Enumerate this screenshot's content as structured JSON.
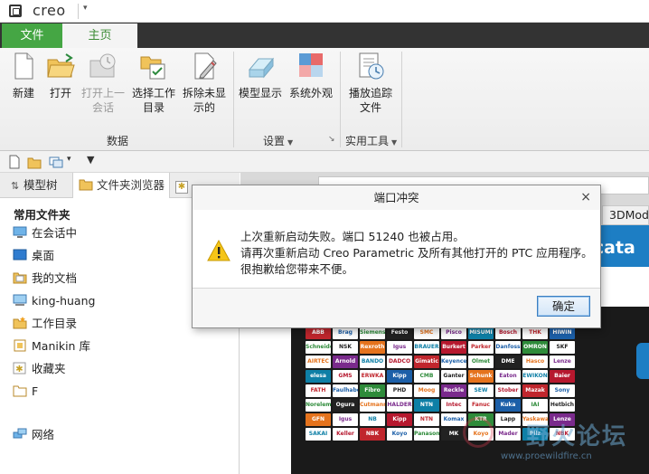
{
  "app": {
    "brand": "creo"
  },
  "tabs": [
    {
      "label": "文件",
      "active": false
    },
    {
      "label": "主页",
      "active": true
    }
  ],
  "ribbon": {
    "buttons": [
      {
        "id": "new",
        "label": "新建",
        "icon": "new-file-icon"
      },
      {
        "id": "open",
        "label": "打开",
        "icon": "open-folder-icon"
      },
      {
        "id": "open-last",
        "label_line1": "打开上一",
        "label_line2": "会话",
        "disabled": true,
        "icon": "open-last-session-icon"
      },
      {
        "id": "select-wd",
        "label_line1": "选择工作",
        "label_line2": "目录",
        "icon": "select-working-directory-icon"
      },
      {
        "id": "erase",
        "label_line1": "拆除未显",
        "label_line2": "示的",
        "icon": "erase-not-displayed-icon"
      },
      {
        "id": "model-display",
        "label": "模型显示",
        "icon": "model-display-icon"
      },
      {
        "id": "system-appearance",
        "label": "系统外观",
        "icon": "system-appearance-icon"
      },
      {
        "id": "playback",
        "label_line1": "播放追踪",
        "label_line2": "文件",
        "icon": "playback-trail-file-icon"
      }
    ],
    "groups": {
      "data": "数据",
      "settings": "设置",
      "utilities": "实用工具"
    }
  },
  "navigator": {
    "tabs": [
      {
        "label": "模型树"
      },
      {
        "label": "文件夹浏览器"
      },
      {
        "label": "收藏夹"
      }
    ],
    "favorites_header": "常用文件夹",
    "items": [
      {
        "label": "在会话中",
        "icon": "monitor-icon"
      },
      {
        "label": "桌面",
        "icon": "desktop-icon"
      },
      {
        "label": "我的文档",
        "icon": "documents-icon"
      },
      {
        "label": "king-huang",
        "icon": "computer-icon"
      },
      {
        "label": "工作目录",
        "icon": "working-directory-icon"
      },
      {
        "label": "Manikin 库",
        "icon": "library-icon"
      },
      {
        "label": "收藏夹",
        "icon": "favorites-icon"
      },
      {
        "label": "F",
        "icon": "folder-icon"
      },
      {
        "label": "网络",
        "icon": "network-icon"
      }
    ]
  },
  "browser": {
    "tab_label": "3DModel",
    "banner_text": "er cata",
    "logos": [
      "ABB",
      "Brag",
      "Siemens",
      "Festo",
      "SMC",
      "Pisco",
      "MISUMI",
      "Bosch",
      "THK",
      "HIWIN",
      "Schneider",
      "NSK",
      "Rexroth",
      "Igus",
      "BRAUER",
      "Burkert",
      "Parker",
      "Danfoss",
      "OMRON",
      "SKF",
      "AIRTEC",
      "Arnold",
      "BANDO",
      "DADCO",
      "Gimatic",
      "Keyence",
      "Olmet",
      "DME",
      "Hasco",
      "Lenze",
      "elesa",
      "GMS",
      "ERWKA",
      "Kipp",
      "CMB",
      "Ganter",
      "Schunk",
      "Eaton",
      "EWIKON",
      "Baier",
      "FATH",
      "Faulhaber",
      "Fibro",
      "PHD",
      "Moog",
      "Reckle",
      "SEW",
      "Stober",
      "Mazak",
      "Sony",
      "Norelem",
      "Ogura",
      "Cutmann",
      "HALDER",
      "NTN",
      "Intec",
      "Fanuc",
      "Kuka",
      "IAI",
      "Hetbich",
      "GFN",
      "Igus",
      "NB",
      "Kipp",
      "NTN",
      "Komax",
      "KTR",
      "Lapp",
      "Yaskawa",
      "Lenze",
      "SAKAI",
      "Keller",
      "NBK",
      "Koyo",
      "Panasonic",
      "MK",
      "Koyo",
      "Mader",
      "Pilz",
      "NBK"
    ]
  },
  "dialog": {
    "title": "端口冲突",
    "line1": "上次重新启动失败。端口 51240 也被占用。",
    "line2": "请再次重新启动 Creo Parametric 及所有其他打开的 PTC 应用程序。",
    "line3": "很抱歉给您带来不便。",
    "ok": "确定",
    "close": "×"
  },
  "watermark": {
    "text": "野火论坛",
    "url": "www.proewildfire.cn"
  }
}
